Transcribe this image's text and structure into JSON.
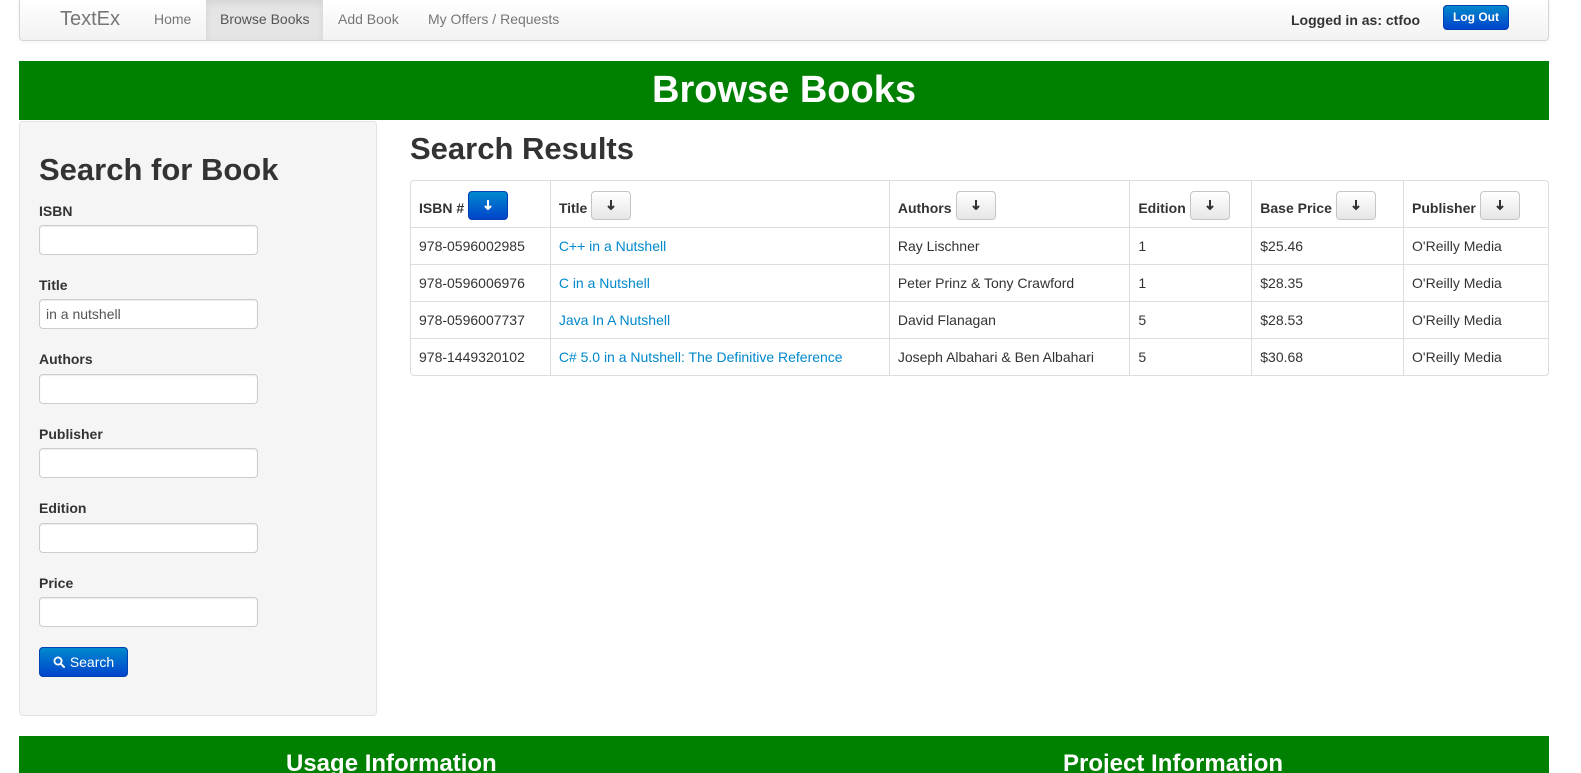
{
  "navbar": {
    "brand": "TextEx",
    "links": [
      "Home",
      "Browse Books",
      "Add Book",
      "My Offers / Requests"
    ],
    "active_link": "Browse Books",
    "logged_in_text": "Logged in as: ctfoo",
    "logout_label": "Log Out"
  },
  "header": {
    "title": "Browse Books"
  },
  "sidebar": {
    "title": "Search for Book",
    "fields": [
      {
        "label": "ISBN",
        "value": "",
        "placeholder": ""
      },
      {
        "label": "Title",
        "value": "in a nutshell",
        "placeholder": ""
      },
      {
        "label": "Authors",
        "value": "",
        "placeholder": ""
      },
      {
        "label": "Publisher",
        "value": "",
        "placeholder": ""
      },
      {
        "label": "Edition",
        "value": "",
        "placeholder": ""
      },
      {
        "label": "Price",
        "value": "",
        "placeholder": ""
      }
    ],
    "search_label": "Search"
  },
  "results": {
    "title": "Search Results",
    "columns": [
      "ISBN #",
      "Title",
      "Authors",
      "Edition",
      "Base Price",
      "Publisher"
    ],
    "active_sort_column": "ISBN #",
    "rows": [
      [
        "978-0596002985",
        "C++ in a Nutshell",
        "Ray Lischner",
        "1",
        "$25.46",
        "O'Reilly Media"
      ],
      [
        "978-0596006976",
        "C in a Nutshell",
        "Peter Prinz & Tony Crawford",
        "1",
        "$28.35",
        "O'Reilly Media"
      ],
      [
        "978-0596007737",
        "Java In A Nutshell",
        "David Flanagan",
        "5",
        "$28.53",
        "O'Reilly Media"
      ],
      [
        "978-1449320102",
        "C# 5.0 in a Nutshell: The Definitive Reference",
        "Joseph Albahari & Ben Albahari",
        "5",
        "$30.68",
        "O'Reilly Media"
      ]
    ]
  },
  "footer": {
    "usage_heading": "Usage Information",
    "project_heading": "Project Information"
  },
  "colors": {
    "header_green": "#008000",
    "primary_blue": "#0044cc",
    "link_blue": "#0088cc"
  }
}
